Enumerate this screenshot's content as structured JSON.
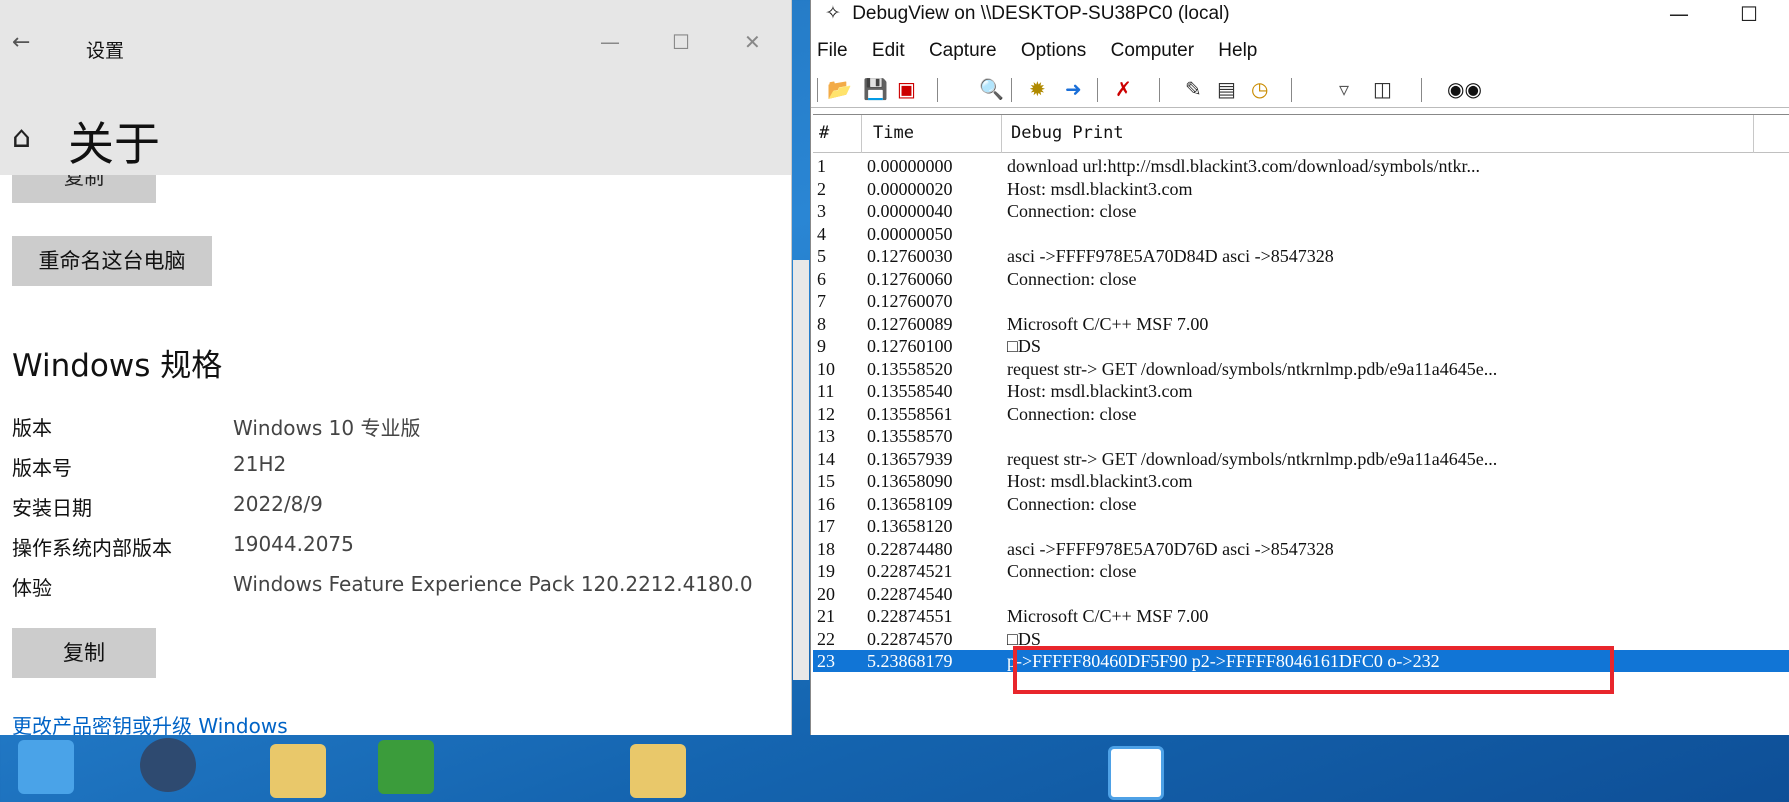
{
  "settings": {
    "title": "设置",
    "page_title": "关于",
    "copy_top": "复制",
    "rename_button": "重命名这台电脑",
    "section_title": "Windows 规格",
    "specs": [
      {
        "key": "版本",
        "value": "Windows 10 专业版"
      },
      {
        "key": "版本号",
        "value": "21H2"
      },
      {
        "key": "安装日期",
        "value": "2022/8/9"
      },
      {
        "key": "操作系统内部版本",
        "value": "19044.2075"
      },
      {
        "key": "体验",
        "value": "Windows Feature Experience Pack 120.2212.4180.0"
      }
    ],
    "copy_button": "复制",
    "link": "更改产品密钥或升级 Windows"
  },
  "debugview": {
    "title": "DebugView on \\\\DESKTOP-SU38PC0 (local)",
    "menu": [
      "File",
      "Edit",
      "Capture",
      "Options",
      "Computer",
      "Help"
    ],
    "columns": [
      "#",
      "Time",
      "Debug Print"
    ],
    "rows": [
      {
        "n": "1",
        "t": "0.00000000",
        "p": "download url:http://msdl.blackint3.com/download/symbols/ntkr..."
      },
      {
        "n": "2",
        "t": "0.00000020",
        "p": "Host: msdl.blackint3.com"
      },
      {
        "n": "3",
        "t": "0.00000040",
        "p": "Connection: close"
      },
      {
        "n": "4",
        "t": "0.00000050",
        "p": ""
      },
      {
        "n": "5",
        "t": "0.12760030",
        "p": "asci ->FFFF978E5A70D84D asci ->8547328"
      },
      {
        "n": "6",
        "t": "0.12760060",
        "p": "Connection: close"
      },
      {
        "n": "7",
        "t": "0.12760070",
        "p": ""
      },
      {
        "n": "8",
        "t": "0.12760089",
        "p": "Microsoft C/C++ MSF 7.00"
      },
      {
        "n": "9",
        "t": "0.12760100",
        "p": "□DS"
      },
      {
        "n": "10",
        "t": "0.13558520",
        "p": "request str-> GET /download/symbols/ntkrnlmp.pdb/e9a11a4645e..."
      },
      {
        "n": "11",
        "t": "0.13558540",
        "p": "Host: msdl.blackint3.com"
      },
      {
        "n": "12",
        "t": "0.13558561",
        "p": "Connection: close"
      },
      {
        "n": "13",
        "t": "0.13558570",
        "p": ""
      },
      {
        "n": "14",
        "t": "0.13657939",
        "p": "request str-> GET /download/symbols/ntkrnlmp.pdb/e9a11a4645e..."
      },
      {
        "n": "15",
        "t": "0.13658090",
        "p": "Host: msdl.blackint3.com"
      },
      {
        "n": "16",
        "t": "0.13658109",
        "p": "Connection: close"
      },
      {
        "n": "17",
        "t": "0.13658120",
        "p": ""
      },
      {
        "n": "18",
        "t": "0.22874480",
        "p": "asci ->FFFF978E5A70D76D asci ->8547328"
      },
      {
        "n": "19",
        "t": "0.22874521",
        "p": "Connection: close"
      },
      {
        "n": "20",
        "t": "0.22874540",
        "p": ""
      },
      {
        "n": "21",
        "t": "0.22874551",
        "p": "Microsoft C/C++ MSF 7.00"
      },
      {
        "n": "22",
        "t": "0.22874570",
        "p": "□DS"
      },
      {
        "n": "23",
        "t": "5.23868179",
        "p": "p->FFFFF80460DF5F90 p2->FFFFF8046161DFC0 o->232",
        "selected": true
      }
    ]
  }
}
